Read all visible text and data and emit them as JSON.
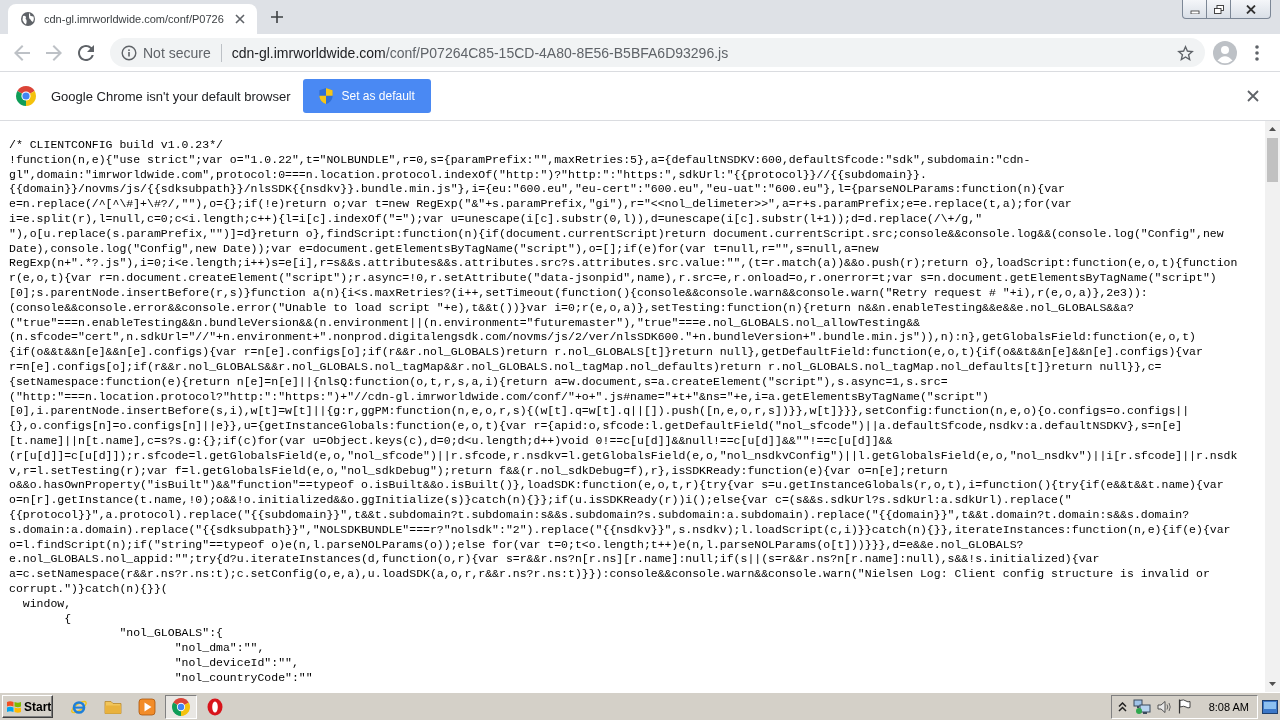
{
  "tabs": [
    {
      "title": "cdn-gl.imrworldwide.com/conf/P0726",
      "selected": true
    }
  ],
  "nav_buttons": [
    {
      "kind": "back",
      "disabled": true
    },
    {
      "kind": "forward",
      "disabled": true
    },
    {
      "kind": "reload",
      "disabled": false
    }
  ],
  "address_bar": {
    "security_label": "Not secure",
    "url_host": "cdn-gl.imrworldwide.com",
    "url_path": "/conf/P07264C85-15CD-4A80-8E56-B5BFA6D93296.js",
    "bookmarked": false
  },
  "infobar": {
    "message": "Google Chrome isn't your default browser",
    "button": "Set as default"
  },
  "code_lines": [
    "/* CLIENTCONFIG build v1.0.23*/",
    "!function(n,e){\"use strict\";var o=\"1.0.22\",t=\"NOLBUNDLE\",r=0,s={paramPrefix:\"\",maxRetries:5},a={defaultNSDKV:600,defaultSfcode:\"sdk\",subdomain:\"cdn-",
    "gl\",domain:\"imrworldwide.com\",protocol:0===n.location.protocol.indexOf(\"http:\")?\"http:\":\"https:\",sdkUrl:\"{{protocol}}//{{subdomain}}.",
    "{{domain}}/novms/js/{{sdksubpath}}/nlsSDK{{nsdkv}}.bundle.min.js\"},i={eu:\"600.eu\",\"eu-cert\":\"600.eu\",\"eu-uat\":\"600.eu\"},l={parseNOLParams:function(n){var",
    "e=n.replace(/^[^\\#]+\\#?/,\"\"),o={};if(!e)return o;var t=new RegExp(\"&\"+s.paramPrefix,\"gi\"),r=\"<<nol_delimeter>>\",a=r+s.paramPrefix;e=e.replace(t,a);for(var",
    "i=e.split(r),l=null,c=0;c<i.length;c++){l=i[c].indexOf(\"=\");var u=unescape(i[c].substr(0,l)),d=unescape(i[c].substr(l+1));d=d.replace(/\\+/g,\"",
    "\"),o[u.replace(s.paramPrefix,\"\")]=d}return o},findScript:function(n){if(document.currentScript)return document.currentScript.src;console&&console.log&&(console.log(\"Config\",new",
    "Date),console.log(\"Config\",new Date));var e=document.getElementsByTagName(\"script\"),o=[];if(e)for(var t=null,r=\"\",s=null,a=new",
    "RegExp(n+\".*?.js\"),i=0;i<e.length;i++)s=e[i],r=s&&s.attributes&&s.attributes.src?s.attributes.src.value:\"\",(t=r.match(a))&&o.push(r);return o},loadScript:function(e,o,t){function",
    "r(e,o,t){var r=n.document.createElement(\"script\");r.async=!0,r.setAttribute(\"data-jsonpid\",name),r.src=e,r.onload=o,r.onerror=t;var s=n.document.getElementsByTagName(\"script\")",
    "[0];s.parentNode.insertBefore(r,s)}function a(n){i<s.maxRetries?(i++,setTimeout(function(){console&&console.warn&&console.warn(\"Retry request # \"+i),r(e,o,a)},2e3)):",
    "(console&&console.error&&console.error(\"Unable to load script \"+e),t&&t())}var i=0;r(e,o,a)},setTesting:function(n){return n&&n.enableTesting&&e&&e.nol_GLOBALS&&a?",
    "(\"true\"===n.enableTesting&&n.bundleVersion&&(n.environment||(n.environment=\"futuremaster\"),\"true\"===e.nol_GLOBALS.nol_allowTesting&&",
    "(n.sfcode=\"cert\",n.sdkUrl=\"//\"+n.environment+\".nonprod.digitalengsdk.com/novms/js/2/ver/nlsSDK600.\"+n.bundleVersion+\".bundle.min.js\")),n):n},getGlobalsField:function(e,o,t)",
    "{if(o&&t&&n[e]&&n[e].configs){var r=n[e].configs[o];if(r&&r.nol_GLOBALS)return r.nol_GLOBALS[t]}return null},getDefaultField:function(e,o,t){if(o&&t&&n[e]&&n[e].configs){var",
    "r=n[e].configs[o];if(r&&r.nol_GLOBALS&&r.nol_GLOBALS.nol_tagMap&&r.nol_GLOBALS.nol_tagMap.nol_defaults)return r.nol_GLOBALS.nol_tagMap.nol_defaults[t]}return null}},c=",
    "{setNamespace:function(e){return n[e]=n[e]||{nlsQ:function(o,t,r,s,a,i){return a=w.document,s=a.createElement(\"script\"),s.async=1,s.src=",
    "(\"http:\"===n.location.protocol?\"http:\":\"https:\")+\"//cdn-gl.imrworldwide.com/conf/\"+o+\".js#name=\"+t+\"&ns=\"+e,i=a.getElementsByTagName(\"script\")",
    "[0],i.parentNode.insertBefore(s,i),w[t]=w[t]||{g:r,ggPM:function(n,e,o,r,s){(w[t].q=w[t].q||[]).push([n,e,o,r,s])}},w[t]}}},setConfig:function(n,e,o){o.configs=o.configs||",
    "{},o.configs[n]=o.configs[n]||e}},u={getInstanceGlobals:function(e,o,t){var r={apid:o,sfcode:l.getDefaultField(\"nol_sfcode\")||a.defaultSfcode,nsdkv:a.defaultNSDKV},s=n[e]",
    "[t.name]||n[t.name],c=s?s.g:{};if(c)for(var u=Object.keys(c),d=0;d<u.length;d++)void 0!==c[u[d]]&&null!==c[u[d]]&&\"\"!==c[u[d]]&&",
    "(r[u[d]]=c[u[d]]);r.sfcode=l.getGlobalsField(e,o,\"nol_sfcode\")||r.sfcode,r.nsdkv=l.getGlobalsField(e,o,\"nol_nsdkvConfig\")||l.getGlobalsField(e,o,\"nol_nsdkv\")||i[r.sfcode]||r.nsdk",
    "v,r=l.setTesting(r);var f=l.getGlobalsField(e,o,\"nol_sdkDebug\");return f&&(r.nol_sdkDebug=f),r},isSDKReady:function(e){var o=n[e];return",
    "o&&o.hasOwnProperty(\"isBuilt\")&&\"function\"==typeof o.isBuilt&&o.isBuilt()},loadSDK:function(e,o,t,r){try{var s=u.getInstanceGlobals(r,o,t),i=function(){try{if(e&&t&&t.name){var",
    "o=n[r].getInstance(t.name,!0);o&&!o.initialized&&o.ggInitialize(s)}catch(n){}};if(u.isSDKReady(r))i();else{var c=(s&&s.sdkUrl?s.sdkUrl:a.sdkUrl).replace(\"",
    "{{protocol}}\",a.protocol).replace(\"{{subdomain}}\",t&&t.subdomain?t.subdomain:s&&s.subdomain?s.subdomain:a.subdomain).replace(\"{{domain}}\",t&&t.domain?t.domain:s&&s.domain?",
    "s.domain:a.domain).replace(\"{{sdksubpath}}\",\"NOLSDKBUNDLE\"===r?\"nolsdk\":\"2\").replace(\"{{nsdkv}}\",s.nsdkv);l.loadScript(c,i)}}catch(n){}},iterateInstances:function(n,e){if(e){var",
    "o=l.findScript(n);if(\"string\"==typeof o)e(n,l.parseNOLParams(o));else for(var t=0;t<o.length;t++)e(n,l.parseNOLParams(o[t]))}}},d=e&&e.nol_GLOBALS?",
    "e.nol_GLOBALS.nol_appid:\"\";try{d?u.iterateInstances(d,function(o,r){var s=r&&r.ns?n[r.ns][r.name]:null;if(s||(s=r&&r.ns?n[r.name]:null),s&&!s.initialized){var",
    "a=c.setNamespace(r&&r.ns?r.ns:t);c.setConfig(o,e,a),u.loadSDK(a,o,r,r&&r.ns?r.ns:t)}}):console&&console.warn&&console.warn(\"Nielsen Log: Client config structure is invalid or",
    "corrupt.\")}catch(n){}}(",
    "  window,",
    "        {",
    "                \"nol_GLOBALS\":{",
    "                        \"nol_dma\":\"\",",
    "                        \"nol_deviceId\":\"\",",
    "                        \"nol_countryCode\":\"\""
  ],
  "taskbar": {
    "start": "Start",
    "apps": [
      {
        "kind": "ie",
        "selected": false
      },
      {
        "kind": "folder",
        "selected": false
      },
      {
        "kind": "media",
        "selected": false
      },
      {
        "kind": "chrome",
        "selected": true
      },
      {
        "kind": "opera",
        "selected": false
      }
    ],
    "clock": "8:08 AM"
  }
}
